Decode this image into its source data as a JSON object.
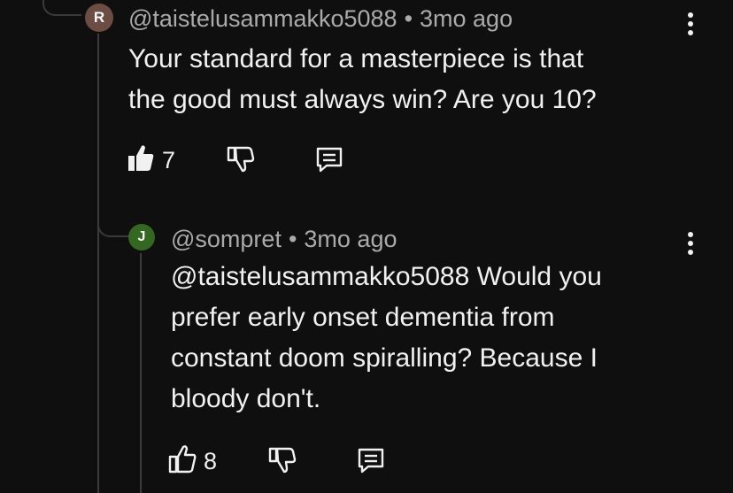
{
  "comments": [
    {
      "avatar_letter": "R",
      "avatar_color": "#6d4c41",
      "handle": "@taistelusammakko5088",
      "separator": "•",
      "time": "3mo ago",
      "lines": [
        "Your standard for a masterpiece is that",
        "the good must always win? Are you 10?"
      ],
      "like_count": "7",
      "liked": true
    },
    {
      "avatar_letter": "J",
      "avatar_color": "#33691e",
      "handle": "@sompret",
      "separator": "•",
      "time": "3mo ago",
      "lines": [
        "@taistelusammakko5088 Would you",
        "prefer early onset dementia from",
        "constant doom spiralling? Because I",
        "bloody don't."
      ],
      "like_count": "8",
      "liked": false
    }
  ],
  "icons": {
    "like": "thumb-up-icon",
    "dislike": "thumb-down-icon",
    "reply": "reply-comment-icon",
    "menu": "more-vertical-icon"
  }
}
